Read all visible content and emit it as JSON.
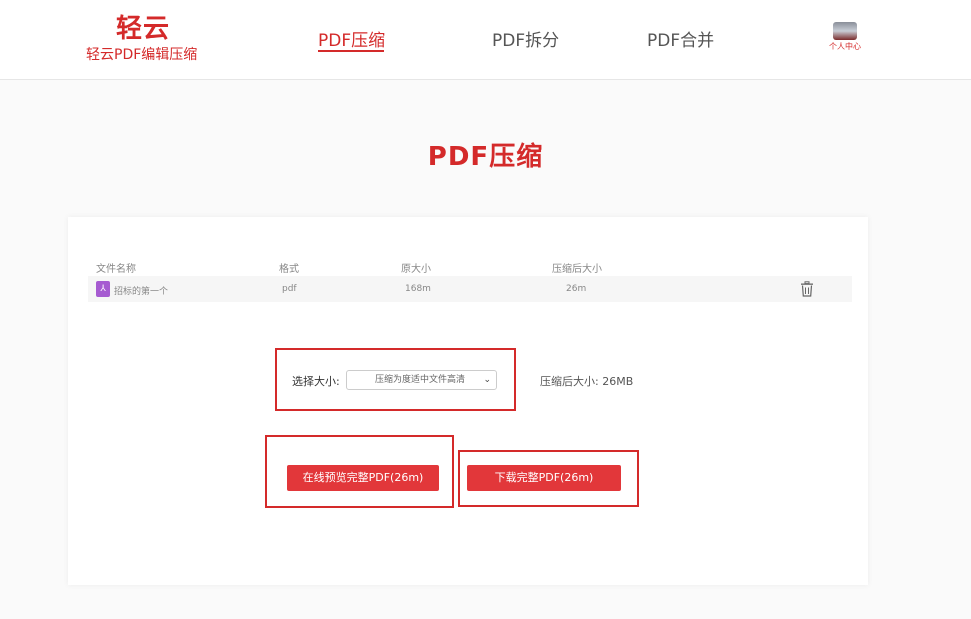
{
  "header": {
    "logo_main": "轻云",
    "logo_sub": "轻云PDF编辑压缩",
    "nav": [
      "PDF压缩",
      "PDF拆分",
      "PDF合并"
    ],
    "user_label": "个人中心"
  },
  "page_title": "PDF压缩",
  "table": {
    "headers": [
      "文件名称",
      "格式",
      "原大小",
      "压缩后大小"
    ],
    "rows": [
      {
        "name": "招标的第一个",
        "format": "pdf",
        "original_size": "168m",
        "compressed_size": "26m"
      }
    ]
  },
  "options": {
    "select_label": "选择大小:",
    "select_value": "压缩为度适中文件高清",
    "after_size": "压缩后大小: 26MB"
  },
  "buttons": {
    "preview": "在线预览完整PDF(26m)",
    "download": "下载完整PDF(26m)"
  },
  "colors": {
    "brand": "#d42a2a",
    "button": "#e2373a",
    "highlight_box": "#d42a2a"
  }
}
